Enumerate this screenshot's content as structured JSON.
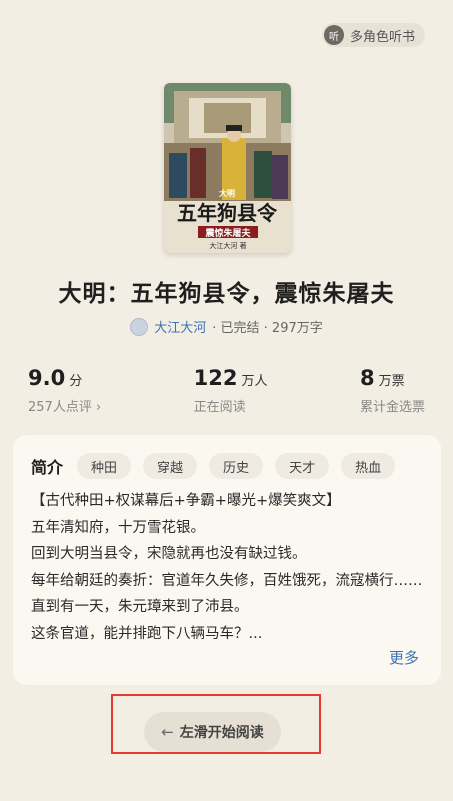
{
  "header": {
    "listen_label": "多角色听书",
    "listen_icon_text": "听"
  },
  "cover": {
    "small_title": "大明",
    "main_title": "五年狗县令",
    "sub_title": "震惊朱屠夫",
    "author_mark": "大江大河 著"
  },
  "book": {
    "title": "大明：五年狗县令，震惊朱屠夫",
    "author": "大江大河",
    "status": "· 已完结 · 297万字"
  },
  "stats": [
    {
      "value": "9.0",
      "unit": "分",
      "sub": "257人点评 ›"
    },
    {
      "value": "122",
      "unit": "万人",
      "sub": "正在阅读"
    },
    {
      "value": "8",
      "unit": "万票",
      "sub": "累计金选票"
    }
  ],
  "intro": {
    "label": "简介",
    "tags": [
      "种田",
      "穿越",
      "历史",
      "天才",
      "热血"
    ],
    "lines": [
      "【古代种田+权谋幕后+争霸+曝光+爆笑爽文】",
      "五年清知府，十万雪花银。",
      "回到大明当县令，宋隐就再也没有缺过钱。",
      "每年给朝廷的奏折：官道年久失修，百姓饿死，流寇横行……",
      "直到有一天，朱元璋来到了沛县。",
      "这条官道，能并排跑下八辆马车？..."
    ],
    "more": "更多"
  },
  "swipe": {
    "label": "左滑开始阅读",
    "arrow": "←"
  }
}
